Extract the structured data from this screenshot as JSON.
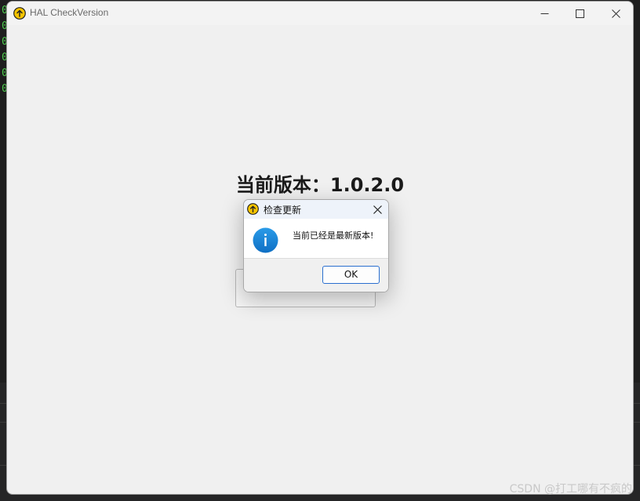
{
  "window": {
    "title": "HAL CheckVersion",
    "minimize_icon": "minimize-icon",
    "maximize_icon": "maximize-icon",
    "close_icon": "close-icon"
  },
  "main": {
    "version_label": "当前版本：1.0.2.0",
    "check_button_label": ""
  },
  "dialog": {
    "title": "检查更新",
    "message": "当前已经是最新版本!",
    "ok_label": "OK",
    "icon": "info-icon"
  },
  "watermark": "CSDN @打工哪有不疯的",
  "colors": {
    "accent": "#2a6fcf",
    "info_icon": "#1a86d9",
    "app_icon": "#f5c400"
  }
}
